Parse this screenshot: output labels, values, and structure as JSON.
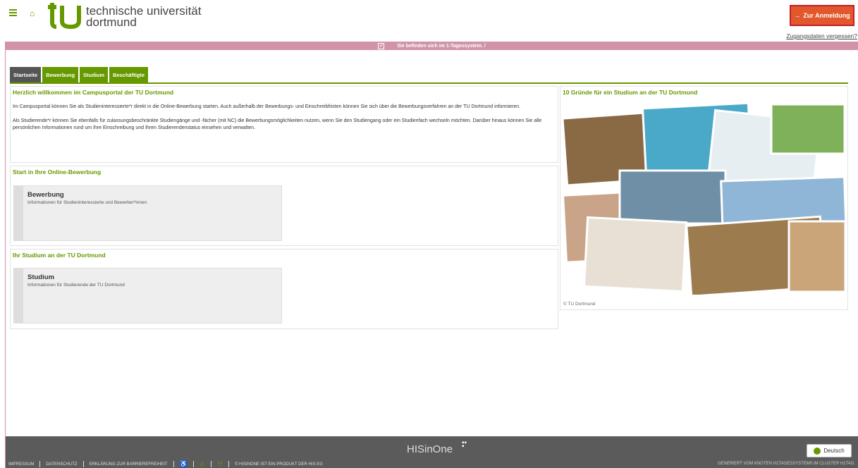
{
  "header": {
    "logo_line1": "technische universität",
    "logo_line2": "dortmund",
    "login_label": "Zur Anmeldung",
    "forgot_label": "Zugangsdaten vergessen?"
  },
  "banner": {
    "text": "Sie befinden sich im 1-Tagessystem. /"
  },
  "tabs": [
    {
      "label": "Startseite"
    },
    {
      "label": "Bewerbung"
    },
    {
      "label": "Studium"
    },
    {
      "label": "Beschäftigte"
    }
  ],
  "welcome": {
    "title": "Herzlich willkommen im Campusportal der TU Dortmund",
    "para1": "Im Campusportal können Sie als Studieninteressierte*r direkt in die Online-Bewerbung starten. Auch außerhalb der Bewerbungs- und Einschreibfristen können Sie sich über die Bewerbungsverfahren an der TU Dortmund informieren.",
    "para2": "Als Studierende*r können Sie ebenfalls für zulassungsbeschränkte Studiengänge und -fächer (mit NC) die Bewerbungsmöglichkeiten nutzen, wenn Sie den Studiengang oder ein Studienfach wechseln möchten. Darüber hinaus können Sie alle persönlichen Informationen rund um Ihre Einschreibung und Ihren Studierendenstatus einsehen und verwalten."
  },
  "start": {
    "title": "Start in Ihre Online-Bewerbung",
    "card_title": "Bewerbung",
    "card_sub": "Informationen für Studieninteressierte und Bewerber*innen"
  },
  "study": {
    "title": "Ihr Studium an der TU Dortmund",
    "card_title": "Studium",
    "card_sub": "Informationen für Studierende der TU Dortmund"
  },
  "reasons": {
    "title": "10 Gründe für ein Studium an der TU Dortmund",
    "copyright": "© TU Dortmund"
  },
  "footer": {
    "brand": "HISinOne",
    "links": [
      "IMPRESSUM",
      "DATENSCHUTZ",
      "ERKLÄRUNG ZUR BARRIEREFREIHEIT"
    ],
    "product": "© HISINONE IST EIN PRODUKT DER HIS EG",
    "language": "Deutsch",
    "generated": "GENERIERT VOM KNOTEN H1TAGESSYSTEM0 IM CLUSTER H1TAG."
  },
  "colors": {
    "accent": "#669900",
    "login": "#e2572b",
    "banner": "#d193a8",
    "footer": "#5b5b5b"
  }
}
